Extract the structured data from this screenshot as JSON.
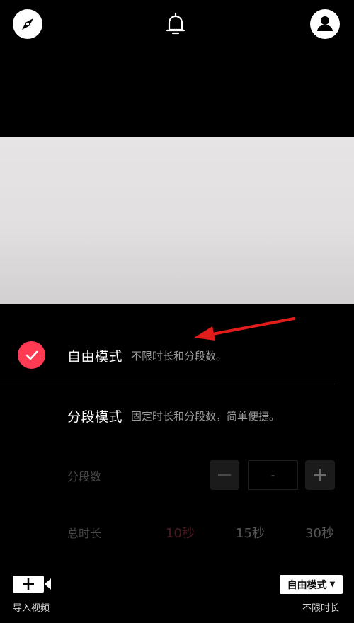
{
  "top_bar": {
    "icons": [
      "compass-icon",
      "bell-icon",
      "profile-icon"
    ]
  },
  "modes": {
    "free": {
      "title": "自由模式",
      "desc": "不限时长和分段数。",
      "selected": true
    },
    "segment": {
      "title": "分段模式",
      "desc": "固定时长和分段数，简单便捷。",
      "selected": false
    }
  },
  "segments": {
    "label": "分段数",
    "value": "-"
  },
  "duration": {
    "label": "总时长",
    "options": [
      "10秒",
      "15秒",
      "30秒"
    ],
    "selected": "10秒"
  },
  "bottom": {
    "import_label": "导入视频",
    "mode_dropdown": "自由模式",
    "mode_sub": "不限时长"
  },
  "colors": {
    "accent": "#fe3b52",
    "background": "#000000"
  }
}
